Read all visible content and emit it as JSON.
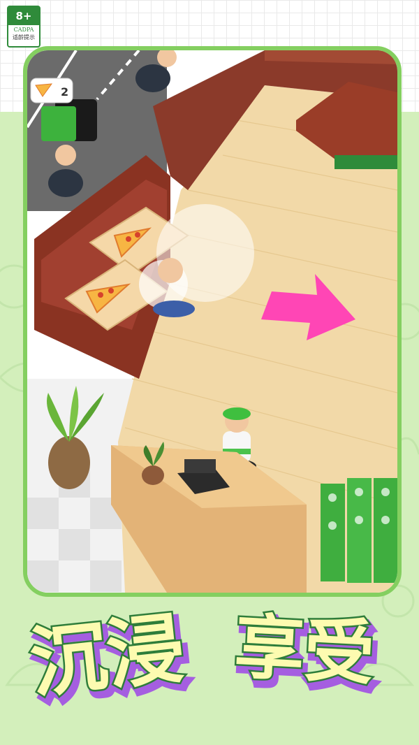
{
  "age_rating": {
    "age": "8+",
    "org": "CADPA",
    "caption": "适龄提示"
  },
  "hud": {
    "order_count": "2"
  },
  "headline": {
    "word1": "沉浸",
    "word2": "享受"
  },
  "colors": {
    "frame": "#84cf60",
    "headline_fill": "#fdfbb0",
    "headline_stroke": "#2e7d3a",
    "headline_shadow": "#a55ee0",
    "arrow": "#ff46b5"
  }
}
